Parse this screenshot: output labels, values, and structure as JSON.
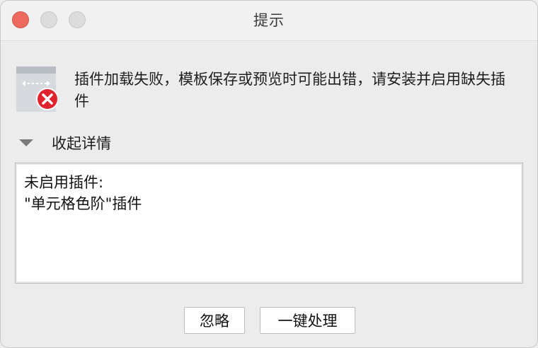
{
  "window": {
    "title": "提示"
  },
  "dialog": {
    "message": "插件加载失败，模板保存或预览时可能出错，请安装并启用缺失插件",
    "details_toggle_label": "收起详情",
    "details": {
      "line1": "未启用插件:",
      "line2": "\"单元格色阶\"插件"
    },
    "buttons": {
      "ignore_label": "忽略",
      "handle_label": "一键处理"
    }
  },
  "colors": {
    "close_button": "#ed6a5e",
    "error_badge": "#e0242e",
    "window_bg": "#ececec"
  },
  "icons": {
    "plugin": "plugin-error-icon",
    "toggle": "disclosure-triangle-icon"
  }
}
